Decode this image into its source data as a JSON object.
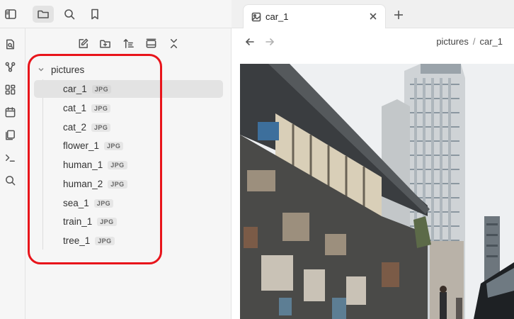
{
  "top_icons": [
    {
      "name": "sidebar-toggle-icon"
    },
    {
      "name": "folder-icon",
      "active": true
    },
    {
      "name": "search-icon"
    },
    {
      "name": "bookmark-icon"
    }
  ],
  "ribbon_icons": [
    "open-quick-switcher-icon",
    "graph-view-icon",
    "canvas-icon",
    "daily-note-icon",
    "templates-icon",
    "command-palette-icon",
    "search-icon"
  ],
  "explorer": {
    "toolbar": [
      "new-note-icon",
      "new-folder-icon",
      "sort-icon",
      "collapse-all-icon",
      "close-chevrons-icon"
    ],
    "folder": "pictures",
    "files": [
      {
        "name": "car_1",
        "ext": "JPG",
        "selected": true
      },
      {
        "name": "cat_1",
        "ext": "JPG"
      },
      {
        "name": "cat_2",
        "ext": "JPG"
      },
      {
        "name": "flower_1",
        "ext": "JPG"
      },
      {
        "name": "human_1",
        "ext": "JPG"
      },
      {
        "name": "human_2",
        "ext": "JPG"
      },
      {
        "name": "sea_1",
        "ext": "JPG"
      },
      {
        "name": "train_1",
        "ext": "JPG"
      },
      {
        "name": "tree_1",
        "ext": "JPG"
      }
    ]
  },
  "tab": {
    "title": "car_1"
  },
  "breadcrumb": {
    "folder": "pictures",
    "separator": "/",
    "file": "car_1"
  },
  "colors": {
    "highlight": "#e8141b",
    "selected": "#e3e3e3"
  }
}
